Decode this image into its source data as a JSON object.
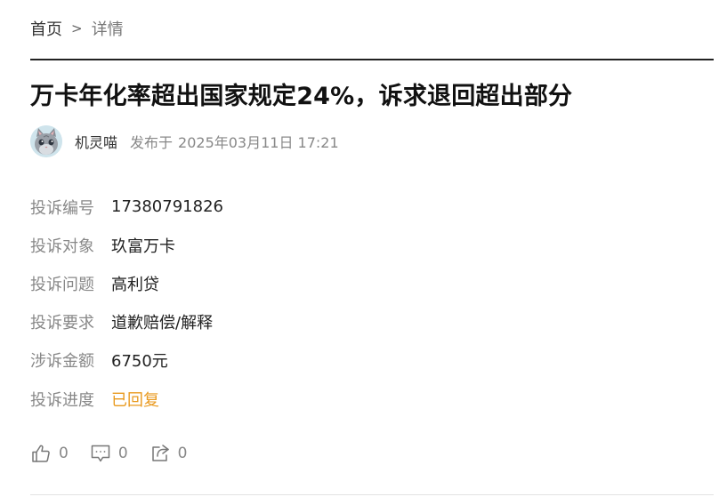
{
  "breadcrumb": {
    "home": "首页",
    "separator": ">",
    "current": "详情"
  },
  "title": "万卡年化率超出国家规定24%，诉求退回超出部分",
  "author": {
    "name": "机灵喵",
    "publish_label": "发布于",
    "publish_time": "2025年03月11日 17:21",
    "avatar_icon": "cat-avatar"
  },
  "fields": [
    {
      "label": "投诉编号",
      "value": "17380791826"
    },
    {
      "label": "投诉对象",
      "value": "玖富万卡"
    },
    {
      "label": "投诉问题",
      "value": "高利贷"
    },
    {
      "label": "投诉要求",
      "value": "道歉赔偿/解释"
    },
    {
      "label": "涉诉金额",
      "value": "6750元"
    },
    {
      "label": "投诉进度",
      "value": "已回复"
    }
  ],
  "actions": {
    "like": "0",
    "comment": "0",
    "share": "0"
  },
  "colors": {
    "status": "#e99a1f",
    "divider": "#222222",
    "label": "#888888"
  }
}
